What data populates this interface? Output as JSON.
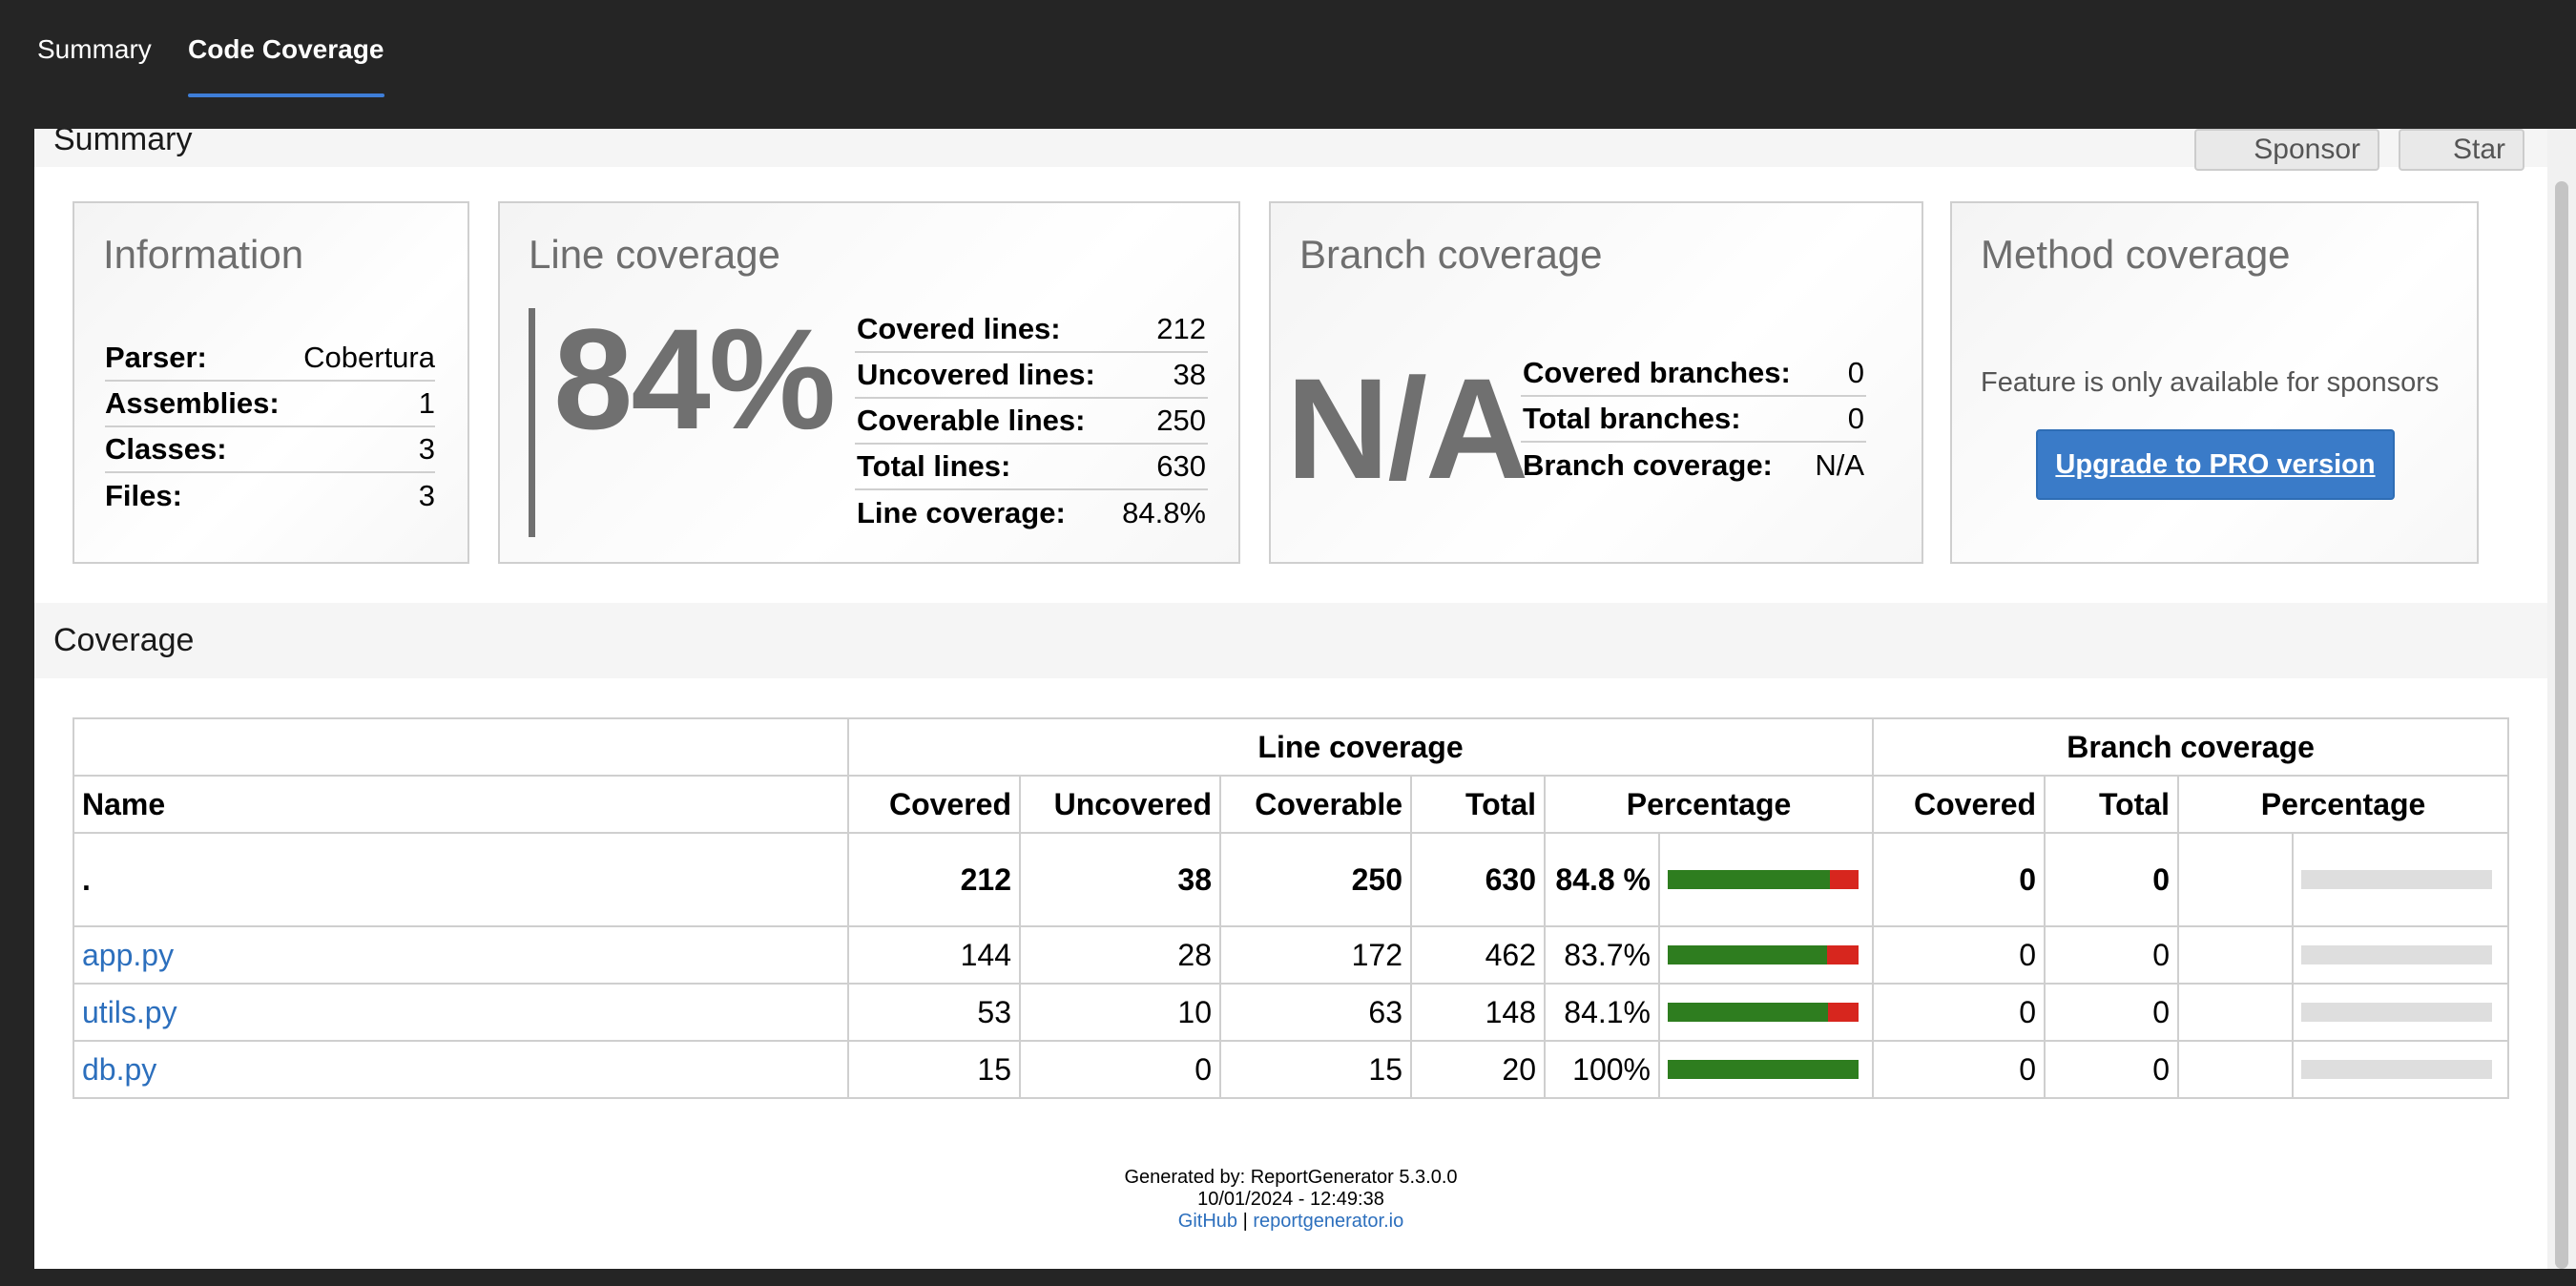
{
  "tabs": [
    {
      "label": "Summary"
    },
    {
      "label": "Code Coverage"
    }
  ],
  "summary_section": {
    "title": "Summary",
    "sponsor_label": "Sponsor",
    "star_label": "Star"
  },
  "information": {
    "title": "Information",
    "rows": [
      {
        "key": "Parser:",
        "value": "Cobertura"
      },
      {
        "key": "Assemblies:",
        "value": "1"
      },
      {
        "key": "Classes:",
        "value": "3"
      },
      {
        "key": "Files:",
        "value": "3"
      }
    ]
  },
  "line_coverage": {
    "title": "Line coverage",
    "big": "84%",
    "rows": [
      {
        "key": "Covered lines:",
        "value": "212"
      },
      {
        "key": "Uncovered lines:",
        "value": "38"
      },
      {
        "key": "Coverable lines:",
        "value": "250"
      },
      {
        "key": "Total lines:",
        "value": "630"
      },
      {
        "key": "Line coverage:",
        "value": "84.8%"
      }
    ]
  },
  "branch_coverage": {
    "title": "Branch coverage",
    "big": "N/A",
    "rows": [
      {
        "key": "Covered branches:",
        "value": "0"
      },
      {
        "key": "Total branches:",
        "value": "0"
      },
      {
        "key": "Branch coverage:",
        "value": "N/A"
      }
    ]
  },
  "method_coverage": {
    "title": "Method coverage",
    "text": "Feature is only available for sponsors",
    "button": "Upgrade to PRO version"
  },
  "coverage_section": {
    "title": "Coverage",
    "group_line": "Line coverage",
    "group_branch": "Branch coverage",
    "headers": {
      "name": "Name",
      "covered": "Covered",
      "uncovered": "Uncovered",
      "coverable": "Coverable",
      "total": "Total",
      "percentage": "Percentage",
      "b_covered": "Covered",
      "b_total": "Total",
      "b_percentage": "Percentage"
    },
    "rows": [
      {
        "name": ".",
        "covered": "212",
        "uncovered": "38",
        "coverable": "250",
        "total": "630",
        "pct": "84.8 %",
        "fraction": 0.848,
        "b_covered": "0",
        "b_total": "0"
      },
      {
        "name": "app.py",
        "covered": "144",
        "uncovered": "28",
        "coverable": "172",
        "total": "462",
        "pct": "83.7%",
        "fraction": 0.837,
        "b_covered": "0",
        "b_total": "0"
      },
      {
        "name": "utils.py",
        "covered": "53",
        "uncovered": "10",
        "coverable": "63",
        "total": "148",
        "pct": "84.1%",
        "fraction": 0.841,
        "b_covered": "0",
        "b_total": "0"
      },
      {
        "name": "db.py",
        "covered": "15",
        "uncovered": "0",
        "coverable": "15",
        "total": "20",
        "pct": "100%",
        "fraction": 1.0,
        "b_covered": "0",
        "b_total": "0"
      }
    ]
  },
  "footer": {
    "generated": "Generated by: ReportGenerator 5.3.0.0",
    "date": "10/01/2024 - 12:49:38",
    "github": "GitHub",
    "separator": "|",
    "site": "reportgenerator.io"
  },
  "colors": {
    "covered": "#2e7d1f",
    "uncovered": "#d7261e",
    "empty": "#dedede",
    "accent": "#3e7ed8",
    "link": "#2c6fbd"
  }
}
